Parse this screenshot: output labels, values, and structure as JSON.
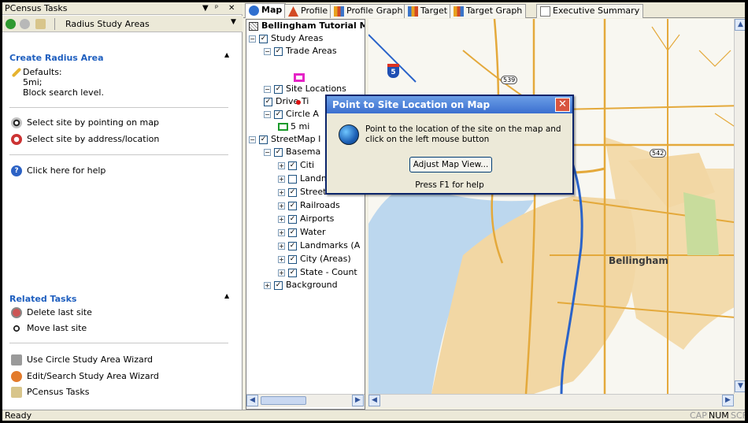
{
  "task_pane": {
    "title": "PCensus Tasks",
    "title_controls": [
      "▾",
      "ᵖ",
      "✕"
    ],
    "toolbar_label": "Radius Study Areas",
    "create_section": {
      "heading": "Create Radius Area",
      "defaults_label": "Defaults:",
      "defaults_line1": "5mi;",
      "defaults_line2": "Block search level.",
      "action1": "Select site by pointing on map",
      "action2": "Select site by address/location",
      "help": "Click here for help"
    },
    "related_section": {
      "heading": "Related Tasks",
      "items": [
        "Delete last site",
        "Move last site",
        "Use Circle Study Area Wizard",
        "Edit/Search Study Area Wizard",
        "PCensus Tasks"
      ]
    }
  },
  "tabs": [
    {
      "label": "Map",
      "active": true
    },
    {
      "label": "Profile",
      "active": false
    },
    {
      "label": "Profile Graph",
      "active": false
    },
    {
      "label": "Target",
      "active": false
    },
    {
      "label": "Target Graph",
      "active": false
    },
    {
      "label": "Executive Summary",
      "active": false
    }
  ],
  "tab_nav": "◁ ▷",
  "toc": {
    "root": "Bellingham Tutorial M",
    "rows": [
      {
        "label": "Study Areas",
        "exp": "⊟",
        "checked": true
      },
      {
        "label": "Trade Areas",
        "exp": "⊟",
        "checked": true
      },
      {
        "label": "Site Locations",
        "exp": "⊟",
        "checked": true
      },
      {
        "label": "Drive Ti",
        "exp": "",
        "checked": true
      },
      {
        "label": "Circle A",
        "exp": "⊟",
        "checked": true
      },
      {
        "label": "5 mi",
        "exp": "",
        "checked": null
      },
      {
        "label": "StreetMap I",
        "exp": "⊟",
        "checked": true
      },
      {
        "label": "Basema",
        "exp": "⊟",
        "checked": true
      },
      {
        "label": "Citi",
        "exp": "⊞",
        "checked": true
      },
      {
        "label": "Landmarks (",
        "exp": "⊞",
        "checked": false
      },
      {
        "label": "Streets and H",
        "exp": "⊞",
        "checked": true
      },
      {
        "label": "Railroads",
        "exp": "⊞",
        "checked": true
      },
      {
        "label": "Airports",
        "exp": "⊞",
        "checked": true
      },
      {
        "label": "Water",
        "exp": "⊞",
        "checked": true
      },
      {
        "label": "Landmarks (A",
        "exp": "⊞",
        "checked": true
      },
      {
        "label": "City (Areas)",
        "exp": "⊞",
        "checked": true
      },
      {
        "label": "State - Count",
        "exp": "⊞",
        "checked": true
      },
      {
        "label": "Background",
        "exp": "⊞",
        "checked": true
      }
    ]
  },
  "map": {
    "city_label": "Bellingham",
    "shield_5": "5",
    "route_539": "539",
    "route_542": "542"
  },
  "dialog": {
    "title": "Point to Site Location on Map",
    "message": "Point to the location of the site on the map and click on the left mouse button",
    "button": "Adjust Map View...",
    "help": "Press F1 for help"
  },
  "status": {
    "text": "Ready",
    "cap": "CAP",
    "num": "NUM",
    "scr": "SCF"
  },
  "colors": {
    "accent": "#1f5fbf",
    "title_bar": "#3b6fcf",
    "land": "#f2d7a4",
    "water": "#bcd7ee",
    "road": "#e4a93b",
    "highway": "#2a63c9"
  }
}
